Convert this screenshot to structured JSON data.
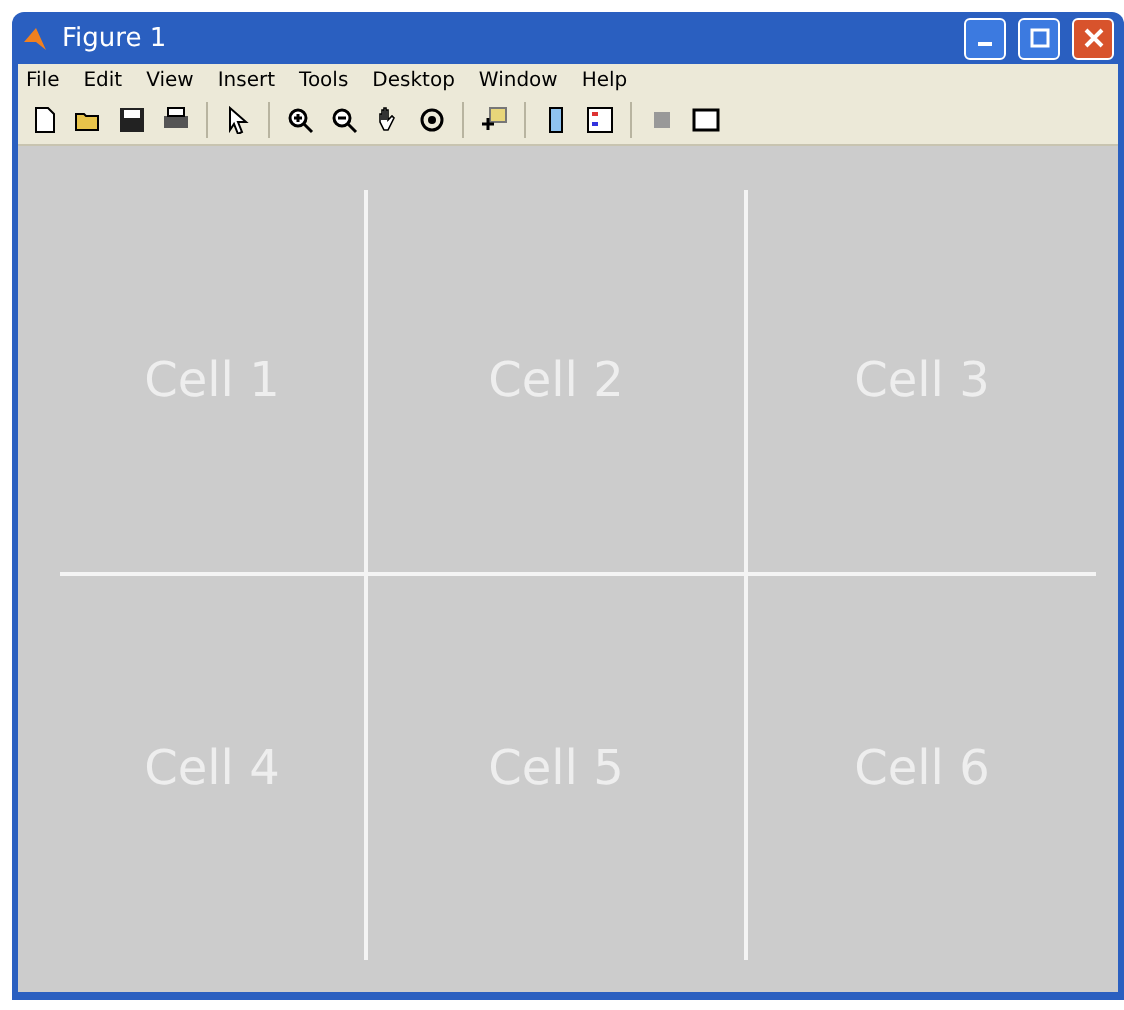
{
  "window": {
    "title": "Figure 1"
  },
  "menu": [
    "File",
    "Edit",
    "View",
    "Insert",
    "Tools",
    "Desktop",
    "Window",
    "Help"
  ],
  "cells": [
    "Cell 1",
    "Cell 2",
    "Cell 3",
    "Cell 4",
    "Cell 5",
    "Cell 6"
  ]
}
